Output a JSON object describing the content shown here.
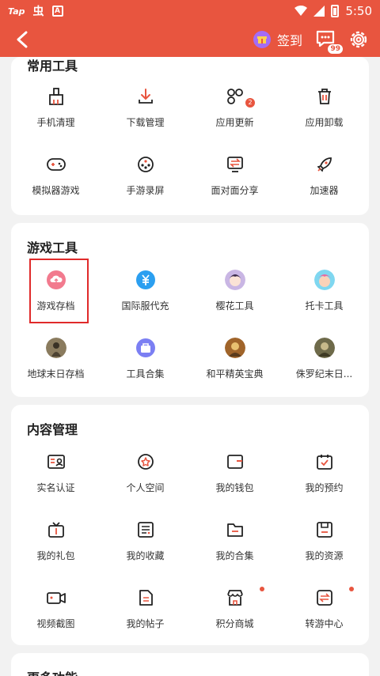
{
  "status_bar": {
    "tap": "Tap",
    "chi": "虫",
    "time": "5:50"
  },
  "header": {
    "signin_label": "签到",
    "msg_badge": "99"
  },
  "sections": {
    "common": {
      "title": "常用工具",
      "items": [
        "手机清理",
        "下载管理",
        "应用更新",
        "应用卸载",
        "模拟器游戏",
        "手游录屏",
        "面对面分享",
        "加速器"
      ],
      "update_badge": "2"
    },
    "game": {
      "title": "游戏工具",
      "items": [
        "游戏存档",
        "国际服代充",
        "樱花工具",
        "托卡工具",
        "地球末日存档",
        "工具合集",
        "和平精英宝典",
        "侏罗纪末日..."
      ]
    },
    "content": {
      "title": "内容管理",
      "items": [
        "实名认证",
        "个人空间",
        "我的钱包",
        "我的预约",
        "我的礼包",
        "我的收藏",
        "我的合集",
        "我的资源",
        "视频截图",
        "我的帖子",
        "积分商城",
        "转游中心"
      ]
    },
    "more": {
      "title": "更多功能"
    }
  },
  "colors": {
    "accent": "#e8553f",
    "page_bg": "#f2f2f2",
    "highlight": "#e02a2a"
  }
}
